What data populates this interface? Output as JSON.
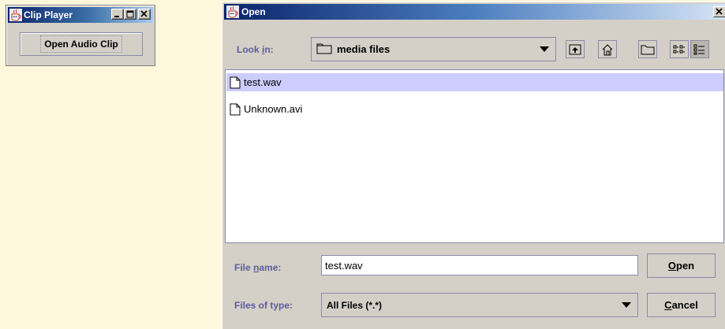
{
  "clip_player": {
    "title": "Clip Player",
    "open_button_label": "Open Audio Clip",
    "icons": {
      "app": "java-cup-icon",
      "minimize": "minimize-icon",
      "maximize": "maximize-icon",
      "close": "close-icon"
    }
  },
  "open_dialog": {
    "title": "Open",
    "look_in": {
      "label_pre": "Look ",
      "label_mnemonic": "i",
      "label_post": "n:",
      "value": "media files",
      "icon": "folder-icon"
    },
    "toolbar": [
      {
        "name": "up-one-level-icon"
      },
      {
        "name": "home-icon"
      },
      {
        "name": "new-folder-icon"
      },
      {
        "name": "list-view-icon"
      },
      {
        "name": "details-view-icon",
        "pressed": true
      }
    ],
    "files": [
      {
        "name": "test.wav",
        "selected": true,
        "icon": "file-icon"
      },
      {
        "name": "Unknown.avi",
        "selected": false,
        "icon": "file-icon"
      }
    ],
    "file_name": {
      "label_pre": "File ",
      "label_mnemonic": "n",
      "label_post": "ame:",
      "value": "test.wav"
    },
    "files_of_type": {
      "label": "Files of type:",
      "value": "All Files (*.*)"
    },
    "open_button": {
      "mnemonic": "O",
      "rest": "pen"
    },
    "cancel_button": {
      "mnemonic": "C",
      "rest": "ancel"
    }
  },
  "colors": {
    "desktop": "#fdf7dc",
    "window_face": "#d4d0c8",
    "title_bar_start": "#0a246a",
    "label_purple": "#5c5c9c",
    "selection": "#ccccff",
    "border": "#8a8aa6"
  }
}
